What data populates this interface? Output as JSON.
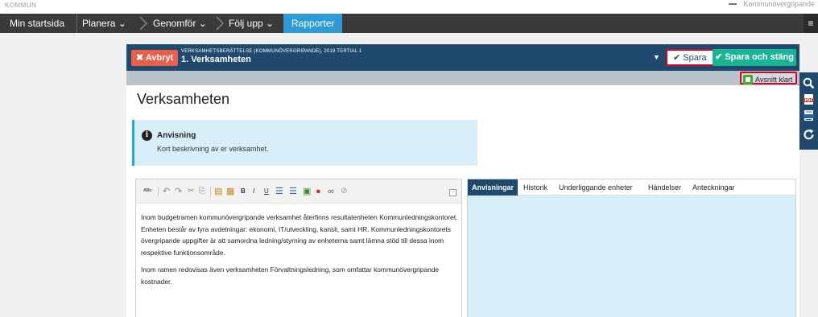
{
  "topstrip": {
    "left_text": "KOMMUN",
    "right_text": "Kommunövergripande"
  },
  "nav": {
    "items": [
      {
        "label": "Min startsida"
      },
      {
        "label": "Planera ⌄"
      },
      {
        "label": "Genomför ⌄"
      },
      {
        "label": "Följ upp ⌄"
      },
      {
        "label": "Rapporter"
      }
    ],
    "menu_icon": "≡"
  },
  "header": {
    "cancel_label": "✖ Avbryt",
    "subtitle": "VERKSAMHETSBERÄTTELSE (KOMMUNÖVERGRIPANDE), 2019 TERTIAL 1",
    "title": "1. Verksamheten",
    "save_label": "✔ Spara",
    "save_close_label": "✔ Spara och stäng"
  },
  "subbar": {
    "section_done_label": "Avsnitt klart"
  },
  "page": {
    "title": "Verksamheten",
    "instruction": {
      "icon": "i",
      "title": "Anvisning",
      "text": "Kort beskrivning av er verksamhet."
    }
  },
  "editor": {
    "collapse": "-",
    "paragraph1": "Inom budgetramen kommunövergripande verksamhet återfinns resultatenheten Kommunledningskontoret. Enheten består av fyra avdelningar: ekonomi, IT/utveckling, kansli, samt HR. Kommunledningskontorets övergripande uppgifter är att samordna ledning/styrning av enheterna samt lämna stöd till dessa inom respektive funktionsområde.",
    "paragraph2": "Inom ramen redovisas även verksamheten Förvaltningsledning, som omfattar kommunövergripande kostnader."
  },
  "sidepanel": {
    "tabs": [
      {
        "label": "Anvisningar"
      },
      {
        "label": "Historik"
      },
      {
        "label": "Underliggande enheter"
      },
      {
        "label": "Händelser"
      },
      {
        "label": "Anteckningar"
      }
    ]
  },
  "colors": {
    "navbar": "#3a3a3a",
    "nav_active": "#2d9cd6",
    "header": "#1f4a6e",
    "cancel": "#e8604c",
    "save_close": "#1ab394",
    "highlight": "#e0002a",
    "info_bg": "#d8eef8"
  }
}
